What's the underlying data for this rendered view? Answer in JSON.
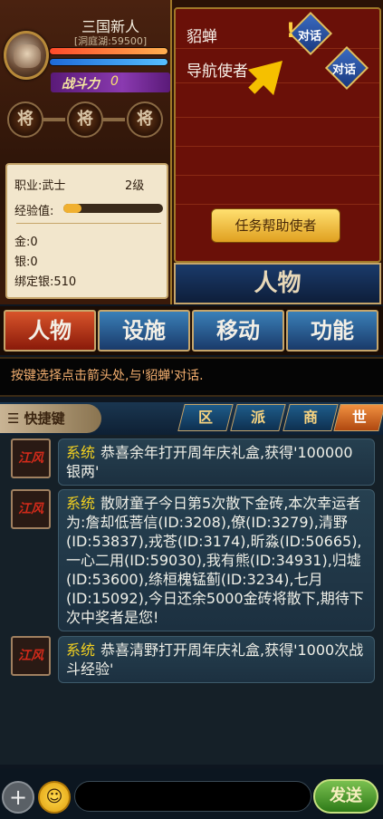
{
  "player": {
    "name": "三国新人",
    "server": "[洞庭湖:59500]",
    "power_label": "战斗力",
    "power_value": "0"
  },
  "badges": [
    "将",
    "将",
    "将"
  ],
  "info": {
    "job": "职业:武士",
    "level": "2级",
    "exp_label": "经验值:",
    "exp_progress": 0.18,
    "gold": "金:0",
    "silver": "银:0",
    "bound_silver": "绑定银:510"
  },
  "npcs": [
    {
      "name": "貂蝉",
      "talk": "对话"
    },
    {
      "name": "导航使者",
      "talk": "对话"
    }
  ],
  "help_button": "任务帮助使者",
  "char_banner": "人物",
  "tabs": [
    "人物",
    "设施",
    "移动",
    "功能"
  ],
  "hint": "按键选择点击箭头处,与'貂蝉'对话.",
  "chat": {
    "quick_label": "快捷键",
    "tabs": [
      "区",
      "派",
      "商",
      "世"
    ],
    "messages": [
      {
        "source": "系统",
        "text": "恭喜余年打开周年庆礼盒,获得'100000银两'"
      },
      {
        "source": "系统",
        "text": "散财童子今日第5次散下金砖,本次幸运者为:詹却低菩信(ID:3208),僚(ID:3279),清野(ID:53837),戎苍(ID:3174),昕淼(ID:50665),一心二用(ID:59030),我有熊(ID:34931),归墟(ID:53600),绦桓槐锰蓟(ID:3234),七月(ID:15092),今日还余5000金砖将散下,期待下次中奖者是您!"
      },
      {
        "source": "系统",
        "text": "恭喜清野打开周年庆礼盒,获得'1000次战斗经验'"
      }
    ],
    "icon_text": "江风"
  },
  "input": {
    "placeholder": "",
    "send_label": "发送",
    "plus": "+",
    "emoji": "☺"
  },
  "colors": {
    "accent_gold": "#f5c000",
    "system_yellow": "#f2d020",
    "hint_orange": "#f5b070"
  }
}
